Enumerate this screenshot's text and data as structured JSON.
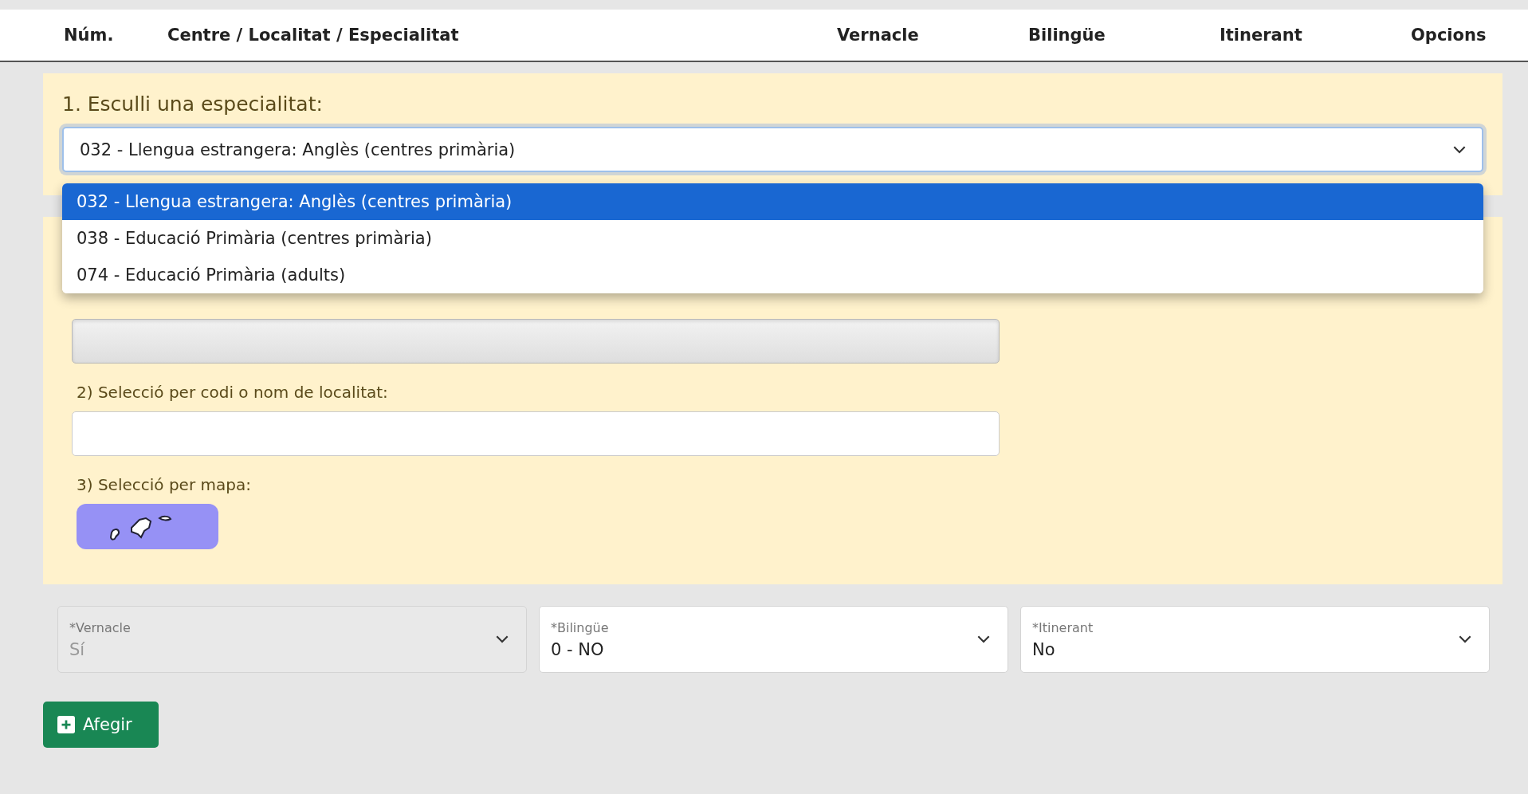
{
  "table_header": {
    "columns": [
      "Núm.",
      "Centre / Localitat / Especialitat",
      "Vernacle",
      "Bilingüe",
      "Itinerant",
      "Opcions"
    ]
  },
  "specialty": {
    "title": "1. Esculli una especialitat:",
    "value": "032 - Llengua estrangera: Anglès (centres primària)",
    "expanded": true,
    "options": [
      {
        "label": "032 - Llengua estrangera: Anglès (centres primària)",
        "selected": true
      },
      {
        "label": "038 - Educació Primària (centres primària)",
        "selected": false
      },
      {
        "label": "074 - Educació Primària (adults)",
        "selected": false
      }
    ]
  },
  "location": {
    "fields": [
      {
        "disabled": true
      },
      {
        "label": "2) Selecció per codi o nom de localitat:",
        "disabled": false
      }
    ],
    "map_label": "3) Selecció per mapa:"
  },
  "selects": [
    {
      "label": "*Vernacle",
      "value": "Sí",
      "disabled": true
    },
    {
      "label": "*Bilingüe",
      "value": "0 - NO",
      "disabled": false
    },
    {
      "label": "*Itinerant",
      "value": "No",
      "disabled": false
    }
  ],
  "add_button": {
    "label": "Afegir"
  }
}
